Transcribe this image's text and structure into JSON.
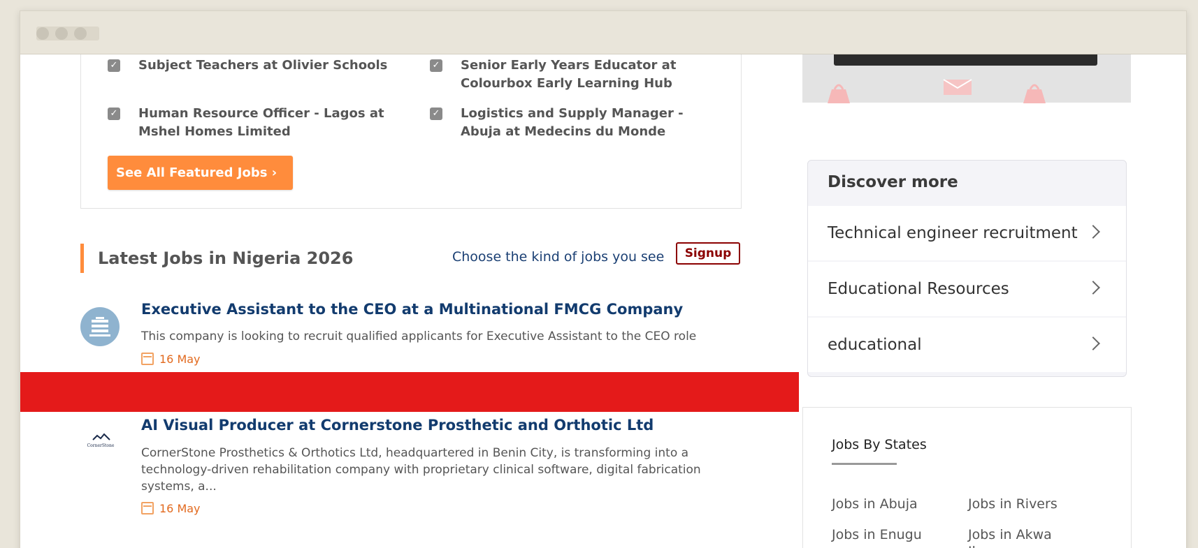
{
  "featured": {
    "jobs": [
      "Subject Teachers at Olivier Schools",
      "Senior Early Years Educator at Colourbox Early Learning Hub",
      "Human Resource Officer - Lagos at Mshel Homes Limited",
      "Logistics and Supply Manager - Abuja at Medecins du Monde"
    ],
    "see_all_label": "See All Featured Jobs ›"
  },
  "latest": {
    "heading": "Latest Jobs in Nigeria 2026",
    "choose_text": "Choose the kind of jobs you see",
    "signup_label": "Signup",
    "jobs": [
      {
        "title": "Executive Assistant to the CEO at a Multinational FMCG Company",
        "desc": "This company is looking to recruit qualified applicants for Executive Assistant to the CEO role",
        "date": "16 May",
        "logo": "building-logo"
      },
      {
        "title": "AI Visual Producer at Cornerstone Prosthetic and Orthotic Ltd",
        "desc": "CornerStone Prosthetics & Orthotics Ltd, headquartered in Benin City, is transforming into a technology-driven rehabilitation company with proprietary clinical software, digital fabrication systems, a...",
        "date": "16 May",
        "logo": "cornerstone-logo",
        "logo_text": "CornerStone"
      }
    ]
  },
  "discover": {
    "title": "Discover more",
    "items": [
      "Technical engineer recruitment",
      "Educational Resources",
      "educational"
    ]
  },
  "states": {
    "title": "Jobs By States",
    "links": [
      "Jobs in Abuja",
      "Jobs in Rivers",
      "Jobs in Enugu",
      "Jobs in Akwa Ibom"
    ]
  },
  "colors": {
    "accent_orange": "#ff8c3c",
    "title_blue": "#123b6e",
    "banner_red": "#e41a1a",
    "signup_maroon": "#8b0000"
  }
}
